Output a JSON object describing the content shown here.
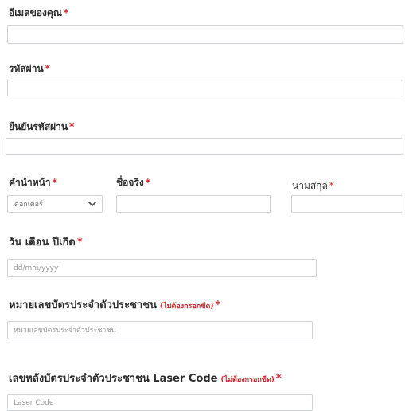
{
  "form": {
    "email": {
      "label": "อีเมลของคุณ",
      "required": "*",
      "value": ""
    },
    "password": {
      "label": "รหัสผ่าน",
      "required": "*",
      "value": ""
    },
    "confirm_password": {
      "label": "ยืนยันรหัสผ่าน",
      "required": "*",
      "value": ""
    },
    "title": {
      "label": "คำนำหน้า",
      "required": "*",
      "selected": "ดอกเตอร์"
    },
    "first_name": {
      "label": "ชื่อจริง",
      "required": "*",
      "value": ""
    },
    "last_name": {
      "label": "นามสกุล",
      "required": "*",
      "value": ""
    },
    "birthdate": {
      "label": "วัน เดือน ปีเกิด",
      "required": "*",
      "placeholder": "dd/mm/yyyy"
    },
    "id_card": {
      "label": "หมายเลขบัตรประจำตัวประชาชน",
      "hint": "(ไม่ต้องกรอกขีด)",
      "required": "*",
      "placeholder": "หมายเลขบัตรประจำตัวประชาชน"
    },
    "laser_code": {
      "label": "เลขหลังบัตรประจำตัวประชาชน Laser Code",
      "hint": "(ไม่ต้องกรอกขีด)",
      "required": "*",
      "placeholder": "Laser Code"
    }
  },
  "colors": {
    "required": "#d6262b",
    "border": "#cfd2d6",
    "label": "#2d2d2d"
  },
  "icons": {
    "select_arrow": "chevron-down-icon"
  }
}
